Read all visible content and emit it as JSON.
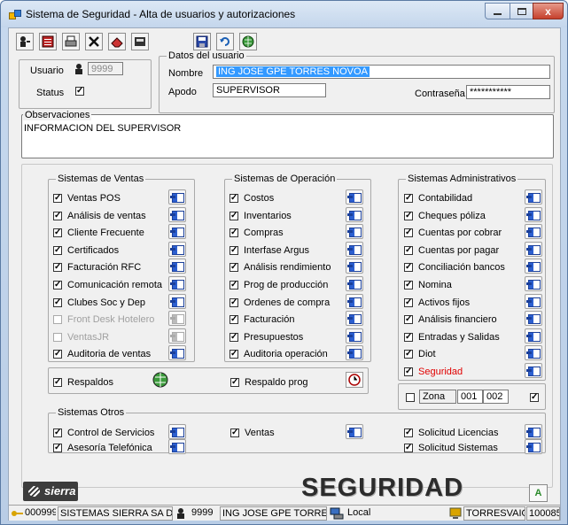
{
  "window": {
    "title": "Sistema de Seguridad - Alta de usuarios y autorizaciones",
    "close_glyph": "x"
  },
  "toolbar": {
    "icons": [
      "user-key-icon",
      "list-icon",
      "print-icon",
      "delete-icon",
      "eraser-icon",
      "calc-icon",
      "save-icon",
      "undo-icon",
      "globe-icon"
    ]
  },
  "user": {
    "label": "Usuario",
    "id": "9999",
    "status_label": "Status",
    "status_checked": true
  },
  "datos": {
    "legend": "Datos del usuario",
    "nombre_label": "Nombre",
    "nombre": "ING JOSE GPE TORRES NOVOA",
    "apodo_label": "Apodo",
    "apodo": "SUPERVISOR",
    "pass_label": "Contraseña",
    "pass": "***********"
  },
  "obs": {
    "legend": "Observaciones",
    "text": "INFORMACION DEL SUPERVISOR"
  },
  "ventas": {
    "legend": "Sistemas de Ventas",
    "items": [
      {
        "label": "Ventas POS",
        "checked": true
      },
      {
        "label": "Análisis de ventas",
        "checked": true
      },
      {
        "label": "Cliente Frecuente",
        "checked": true
      },
      {
        "label": "Certificados",
        "checked": true
      },
      {
        "label": "Facturación RFC",
        "checked": true
      },
      {
        "label": "Comunicación remota",
        "checked": true
      },
      {
        "label": "Clubes Soc y Dep",
        "checked": true
      },
      {
        "label": "Front Desk Hotelero",
        "checked": false,
        "disabled": true
      },
      {
        "label": "VentasJR",
        "checked": false,
        "disabled": true
      },
      {
        "label": "Auditoria de ventas",
        "checked": true
      }
    ]
  },
  "operacion": {
    "legend": "Sistemas de Operación",
    "items": [
      {
        "label": "Costos",
        "checked": true
      },
      {
        "label": "Inventarios",
        "checked": true
      },
      {
        "label": "Compras",
        "checked": true
      },
      {
        "label": "Interfase Argus",
        "checked": true
      },
      {
        "label": "Análisis rendimiento",
        "checked": true
      },
      {
        "label": "Prog de producción",
        "checked": true
      },
      {
        "label": "Ordenes de compra",
        "checked": true
      },
      {
        "label": "Facturación",
        "checked": true
      },
      {
        "label": "Presupuestos",
        "checked": true
      },
      {
        "label": "Auditoria operación",
        "checked": true
      }
    ]
  },
  "admin": {
    "legend": "Sistemas Administrativos",
    "items": [
      {
        "label": "Contabilidad",
        "checked": true
      },
      {
        "label": "Cheques póliza",
        "checked": true
      },
      {
        "label": "Cuentas por cobrar",
        "checked": true
      },
      {
        "label": "Cuentas por pagar",
        "checked": true
      },
      {
        "label": "Conciliación bancos",
        "checked": true
      },
      {
        "label": "Nomina",
        "checked": true
      },
      {
        "label": "Activos fijos",
        "checked": true
      },
      {
        "label": "Análisis financiero",
        "checked": true
      },
      {
        "label": "Entradas y Salidas",
        "checked": true
      },
      {
        "label": "Diot",
        "checked": true
      },
      {
        "label": "Seguridad",
        "checked": true,
        "red": true
      }
    ]
  },
  "respaldos": {
    "label": "Respaldos",
    "checked": true
  },
  "respaldo_prog": {
    "label": "Respaldo prog",
    "checked": true
  },
  "zona": {
    "label": "Zona",
    "from": "001",
    "to": "002",
    "checked_left": false,
    "checked_right": true
  },
  "otros": {
    "legend": "Sistemas Otros",
    "items": [
      {
        "label": "Control de Servicios",
        "checked": true
      },
      {
        "label": "Asesoría Telefónica",
        "checked": true
      },
      {
        "label": "Ventas",
        "checked": true
      },
      {
        "label": "Solicitud Licencias",
        "checked": true
      },
      {
        "label": "Solicitud Sistemas",
        "checked": true
      }
    ]
  },
  "brand": {
    "logo": "sierra",
    "seguridad": "SEGURIDAD",
    "a_button": "A"
  },
  "statusbar": {
    "code": "000999",
    "company": "SISTEMAS SIERRA SA DE C\\",
    "user_id": "9999",
    "user_name": "ING JOSE GPE TORRES N(",
    "local": "Local",
    "machine": "TORRESVAIO\\",
    "num": "100085"
  },
  "colors": {
    "title_bg": "#c4d6ec",
    "selection": "#3399ff",
    "red_label": "#e00000"
  }
}
